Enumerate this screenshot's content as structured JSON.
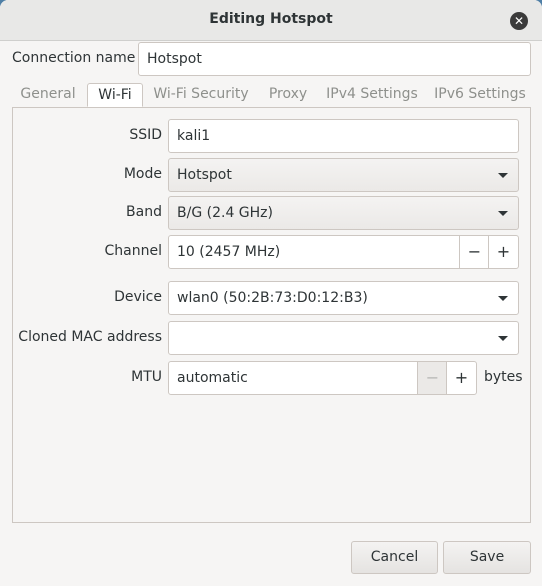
{
  "window": {
    "title": "Editing Hotspot",
    "close_icon": "close-icon"
  },
  "connection": {
    "label": "Connection name",
    "value": "Hotspot"
  },
  "tabs": [
    {
      "label": "General",
      "active": false
    },
    {
      "label": "Wi-Fi",
      "active": true
    },
    {
      "label": "Wi-Fi Security",
      "active": false
    },
    {
      "label": "Proxy",
      "active": false
    },
    {
      "label": "IPv4 Settings",
      "active": false
    },
    {
      "label": "IPv6 Settings",
      "active": false
    }
  ],
  "wifi": {
    "ssid": {
      "label": "SSID",
      "value": "kali1"
    },
    "mode": {
      "label": "Mode",
      "value": "Hotspot"
    },
    "band": {
      "label": "Band",
      "value": "B/G (2.4 GHz)"
    },
    "channel": {
      "label": "Channel",
      "value": "10 (2457 MHz)",
      "minus": "−",
      "plus": "+"
    },
    "device": {
      "label": "Device",
      "value": "wlan0 (50:2B:73:D0:12:B3)"
    },
    "cloned_mac": {
      "label": "Cloned MAC address",
      "value": ""
    },
    "mtu": {
      "label": "MTU",
      "value": "automatic",
      "minus": "−",
      "plus": "+",
      "unit": "bytes"
    }
  },
  "buttons": {
    "cancel": "Cancel",
    "save": "Save"
  }
}
